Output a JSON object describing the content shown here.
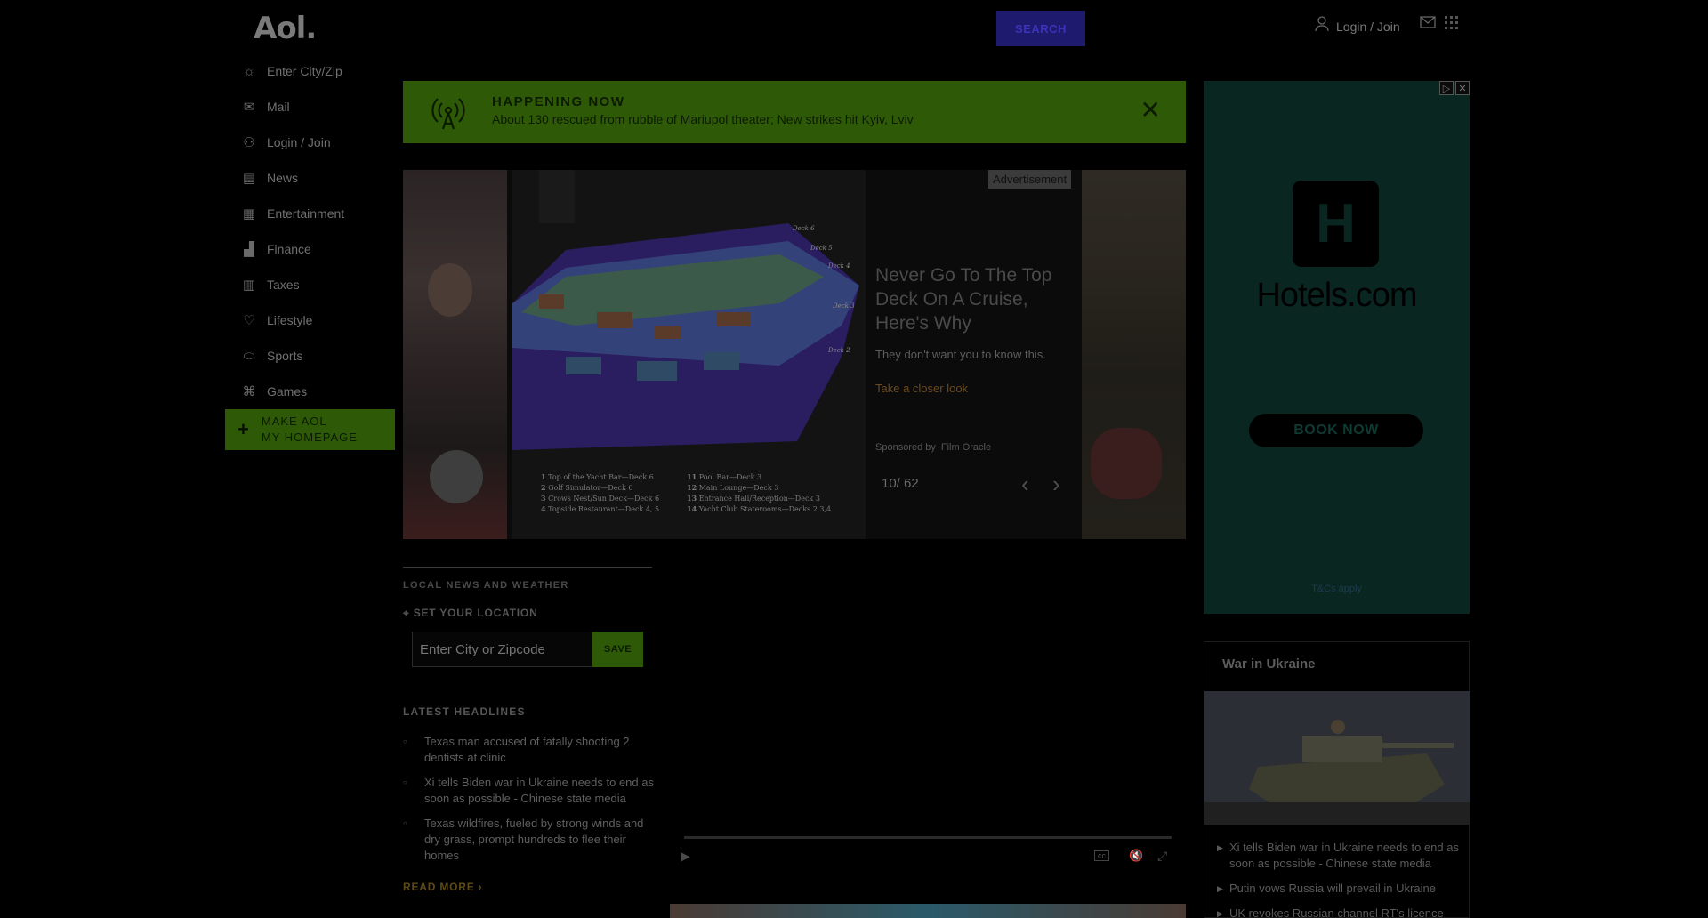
{
  "header": {
    "logo": "Aol.",
    "search_label": "SEARCH",
    "login_label": "Login / Join"
  },
  "leftnav": {
    "items": [
      {
        "label": "Enter City/Zip",
        "icon": "weather-icon"
      },
      {
        "label": "Mail",
        "icon": "mail-icon"
      },
      {
        "label": "Login / Join",
        "icon": "user-icon"
      },
      {
        "label": "News",
        "icon": "news-icon"
      },
      {
        "label": "Entertainment",
        "icon": "clapper-icon"
      },
      {
        "label": "Finance",
        "icon": "chart-icon"
      },
      {
        "label": "Taxes",
        "icon": "document-icon"
      },
      {
        "label": "Lifestyle",
        "icon": "heart-icon"
      },
      {
        "label": "Sports",
        "icon": "football-icon"
      },
      {
        "label": "Games",
        "icon": "gamepad-icon"
      }
    ],
    "make_aol_line1": "MAKE AOL",
    "make_aol_line2": "MY HOMEPAGE"
  },
  "happening": {
    "title": "HAPPENING NOW",
    "text": "About 130 rescued from rubble of Mariupol theater; New strikes hit Kyiv, Lviv"
  },
  "carousel": {
    "ad_tag": "Advertisement",
    "headline": "Never Go To The Top Deck On A Cruise, Here's Why",
    "description": "They don't want you to know this.",
    "link": "Take a closer look",
    "sponsored_by": "Sponsored by",
    "sponsor": "Film Oracle",
    "counter": "10/ 62",
    "legend": [
      {
        "num": "1",
        "text": "Top of the Yacht Bar—Deck 6"
      },
      {
        "num": "2",
        "text": "Golf Simulator—Deck 6"
      },
      {
        "num": "3",
        "text": "Crows Nest/Sun Deck—Deck 6"
      },
      {
        "num": "4",
        "text": "Topside Restaurant—Deck 4, 5"
      },
      {
        "num": "11",
        "text": "Pool Bar—Deck 3"
      },
      {
        "num": "12",
        "text": "Main Lounge—Deck 3"
      },
      {
        "num": "13",
        "text": "Entrance Hall/Reception—Deck 3"
      },
      {
        "num": "14",
        "text": "Yacht Club Staterooms—Decks 2,3,4"
      }
    ],
    "deck_labels": [
      "Deck 6",
      "Deck 5",
      "Deck 4",
      "Deck 3",
      "Deck 2"
    ]
  },
  "right_ad": {
    "brand": "Hotels.com",
    "logo_letter": "H",
    "cta": "BOOK NOW",
    "tcs": "T&Cs apply"
  },
  "local": {
    "title": "LOCAL NEWS AND WEATHER",
    "set_location": "SET YOUR LOCATION",
    "input_placeholder": "Enter City or Zipcode",
    "save_label": "SAVE",
    "latest_title": "LATEST HEADLINES",
    "headlines": [
      "Texas man accused of fatally shooting 2 dentists at clinic",
      "Xi tells Biden war in Ukraine needs to end as soon as possible - Chinese state media",
      "Texas wildfires, fueled by strong winds and dry grass, prompt hundreds to flee their homes"
    ],
    "read_more": "READ MORE ›"
  },
  "video": {
    "cc_label": "cc"
  },
  "ukraine": {
    "title": "War in Ukraine",
    "items": [
      "Xi tells Biden war in Ukraine needs to end as soon as possible - Chinese state media",
      "Putin vows Russia will prevail in Ukraine",
      "UK revokes Russian channel RT's licence"
    ]
  },
  "colors": {
    "accent_green": "#2e5a08",
    "search_blue": "#1e1a6e",
    "link_orange": "#6b4a1f"
  }
}
